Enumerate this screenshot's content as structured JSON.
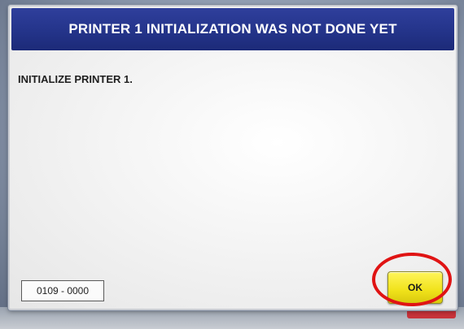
{
  "dialog": {
    "title": "PRINTER 1 INITIALIZATION WAS NOT DONE YET",
    "message": "INITIALIZE PRINTER 1.",
    "error_code": "0109 - 0000",
    "ok_label": "OK"
  },
  "colors": {
    "header_bg": "#24348a",
    "ok_button": "#f0e21a",
    "highlight": "#e01414"
  }
}
